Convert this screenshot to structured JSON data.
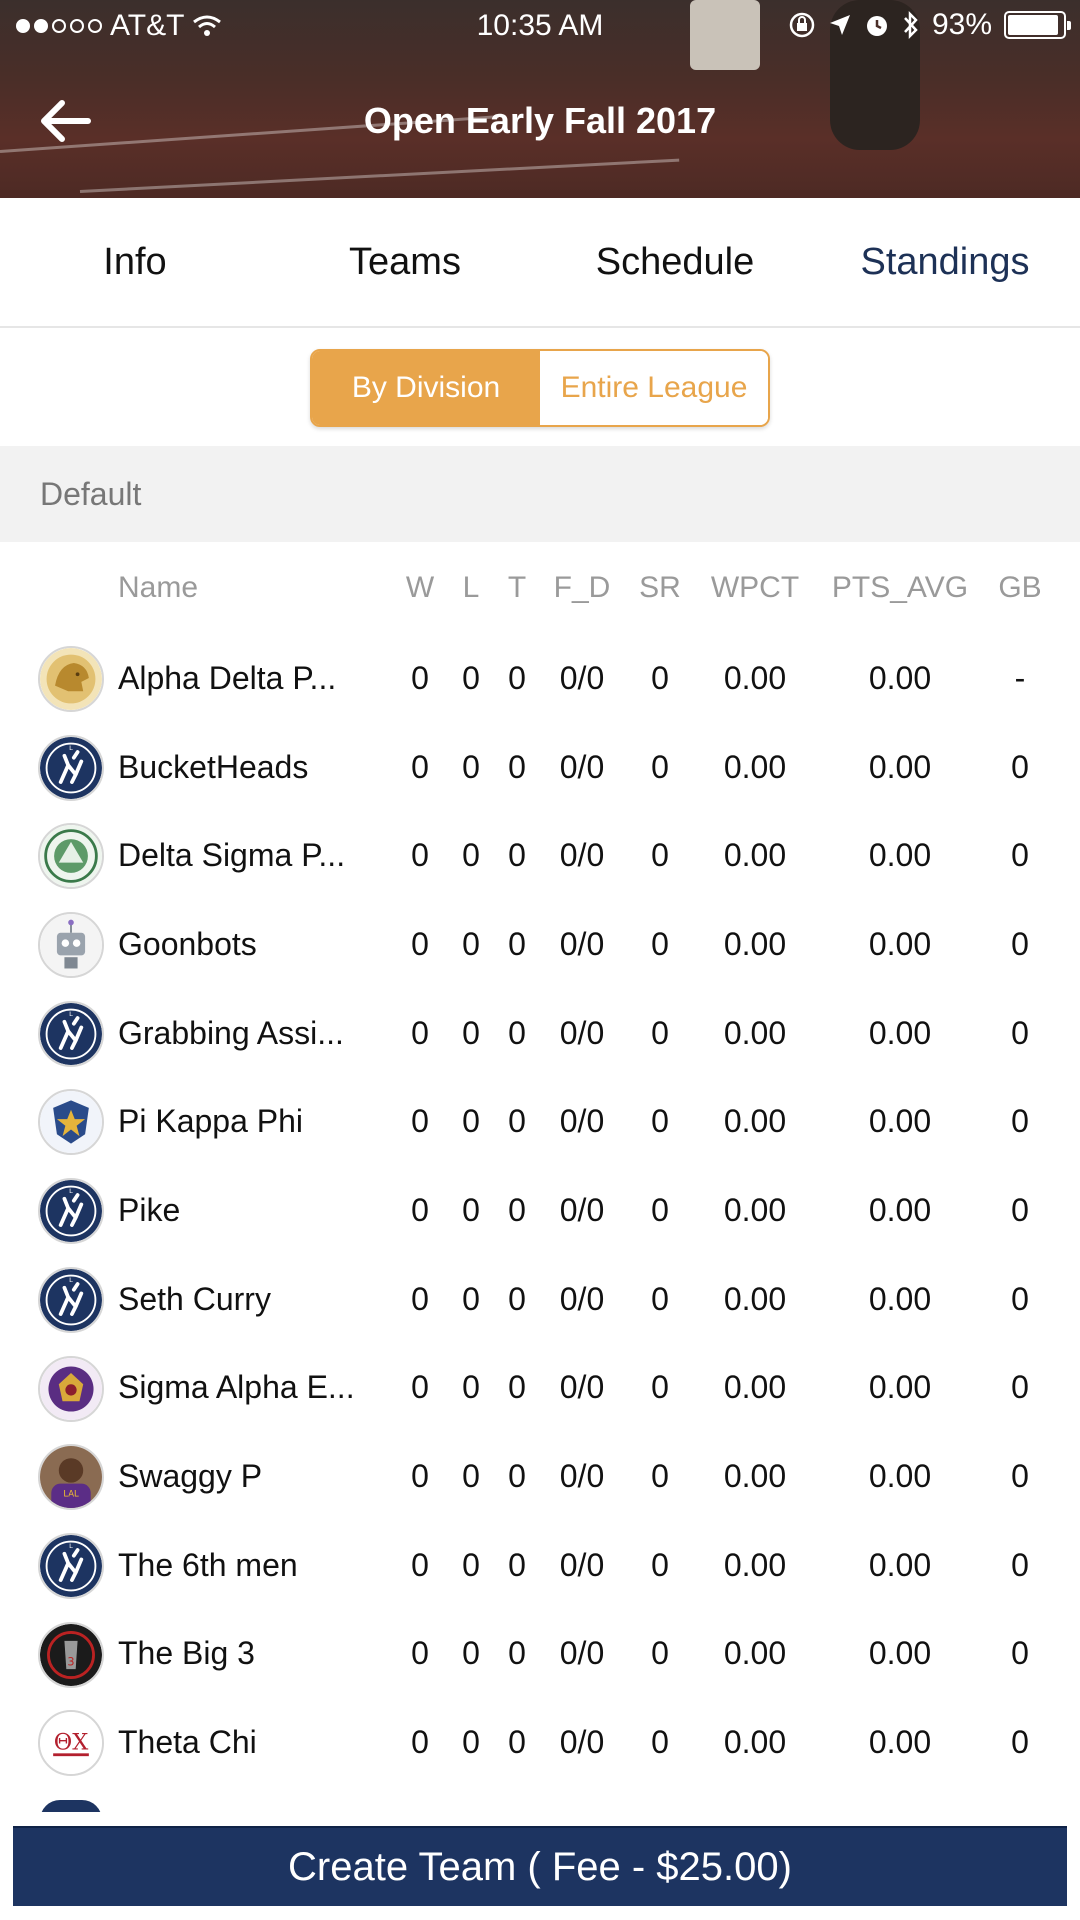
{
  "status_bar": {
    "carrier": "AT&T",
    "time": "10:35 AM",
    "battery": "93%"
  },
  "header": {
    "title": "Open Early Fall 2017"
  },
  "tabs": [
    {
      "label": "Info",
      "active": false
    },
    {
      "label": "Teams",
      "active": false
    },
    {
      "label": "Schedule",
      "active": false
    },
    {
      "label": "Standings",
      "active": true
    }
  ],
  "segmented": {
    "by_division": "By Division",
    "entire_league": "Entire League",
    "selected": "by_division"
  },
  "division": {
    "name": "Default"
  },
  "table": {
    "columns": {
      "name": "Name",
      "w": "W",
      "l": "L",
      "t": "T",
      "fd": "F_D",
      "sr": "SR",
      "wpct": "WPCT",
      "pts_avg": "PTS_AVG",
      "gb": "GB"
    },
    "rows": [
      {
        "name": "Alpha Delta P...",
        "logo": "lion-crest",
        "w": "0",
        "l": "0",
        "t": "0",
        "fd": "0/0",
        "sr": "0",
        "wpct": "0.00",
        "pts_avg": "0.00",
        "gb": "-"
      },
      {
        "name": "BucketHeads",
        "logo": "league-default",
        "w": "0",
        "l": "0",
        "t": "0",
        "fd": "0/0",
        "sr": "0",
        "wpct": "0.00",
        "pts_avg": "0.00",
        "gb": "0"
      },
      {
        "name": "Delta Sigma P...",
        "logo": "green-seal",
        "w": "0",
        "l": "0",
        "t": "0",
        "fd": "0/0",
        "sr": "0",
        "wpct": "0.00",
        "pts_avg": "0.00",
        "gb": "0"
      },
      {
        "name": "Goonbots",
        "logo": "robot",
        "w": "0",
        "l": "0",
        "t": "0",
        "fd": "0/0",
        "sr": "0",
        "wpct": "0.00",
        "pts_avg": "0.00",
        "gb": "0"
      },
      {
        "name": "Grabbing Assi...",
        "logo": "league-default",
        "w": "0",
        "l": "0",
        "t": "0",
        "fd": "0/0",
        "sr": "0",
        "wpct": "0.00",
        "pts_avg": "0.00",
        "gb": "0"
      },
      {
        "name": "Pi Kappa Phi",
        "logo": "star-shield",
        "w": "0",
        "l": "0",
        "t": "0",
        "fd": "0/0",
        "sr": "0",
        "wpct": "0.00",
        "pts_avg": "0.00",
        "gb": "0"
      },
      {
        "name": "Pike",
        "logo": "league-default",
        "w": "0",
        "l": "0",
        "t": "0",
        "fd": "0/0",
        "sr": "0",
        "wpct": "0.00",
        "pts_avg": "0.00",
        "gb": "0"
      },
      {
        "name": "Seth Curry",
        "logo": "league-default",
        "w": "0",
        "l": "0",
        "t": "0",
        "fd": "0/0",
        "sr": "0",
        "wpct": "0.00",
        "pts_avg": "0.00",
        "gb": "0"
      },
      {
        "name": "Sigma Alpha E...",
        "logo": "purple-crest",
        "w": "0",
        "l": "0",
        "t": "0",
        "fd": "0/0",
        "sr": "0",
        "wpct": "0.00",
        "pts_avg": "0.00",
        "gb": "0"
      },
      {
        "name": "Swaggy P",
        "logo": "player-photo",
        "w": "0",
        "l": "0",
        "t": "0",
        "fd": "0/0",
        "sr": "0",
        "wpct": "0.00",
        "pts_avg": "0.00",
        "gb": "0"
      },
      {
        "name": "The 6th men",
        "logo": "league-default",
        "w": "0",
        "l": "0",
        "t": "0",
        "fd": "0/0",
        "sr": "0",
        "wpct": "0.00",
        "pts_avg": "0.00",
        "gb": "0"
      },
      {
        "name": "The Big 3",
        "logo": "dark-emblem",
        "w": "0",
        "l": "0",
        "t": "0",
        "fd": "0/0",
        "sr": "0",
        "wpct": "0.00",
        "pts_avg": "0.00",
        "gb": "0"
      },
      {
        "name": "Theta Chi",
        "logo": "theta-chi",
        "w": "0",
        "l": "0",
        "t": "0",
        "fd": "0/0",
        "sr": "0",
        "wpct": "0.00",
        "pts_avg": "0.00",
        "gb": "0"
      }
    ]
  },
  "footer": {
    "create_team_label": "Create Team ( Fee - $25.00)"
  },
  "colors": {
    "accent": "#e8a54b",
    "navy": "#1d3461",
    "active_tab": "#1d3156"
  },
  "icons": {
    "back": "arrow-left-icon",
    "wifi": "wifi-icon",
    "lock": "orientation-lock-icon",
    "location": "location-arrow-icon",
    "alarm": "alarm-icon",
    "bluetooth": "bluetooth-icon",
    "battery": "battery-icon"
  }
}
